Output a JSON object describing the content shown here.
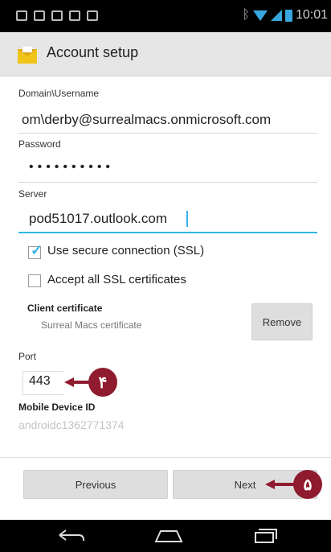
{
  "statusbar": {
    "time": "10:01"
  },
  "actionbar": {
    "title": "Account setup"
  },
  "form": {
    "domain_label": "Domain\\Username",
    "domain_value": "om\\derby@surrealmacs.onmicrosoft.com",
    "password_label": "Password",
    "password_value": "••••••••••",
    "server_label": "Server",
    "server_value": "pod51017.outlook.com",
    "ssl_label": "Use secure connection (SSL)",
    "ssl_checked": true,
    "accept_ssl_label": "Accept all SSL certificates",
    "accept_ssl_checked": false,
    "client_cert_title": "Client certificate",
    "client_cert_value": "Surreal Macs certificate",
    "remove_label": "Remove",
    "port_label": "Port",
    "port_value": "443",
    "device_id_label": "Mobile Device ID",
    "device_id_value": "androidc1362771374"
  },
  "buttons": {
    "previous": "Previous",
    "next": "Next"
  },
  "callouts": {
    "port_marker": "۴",
    "next_marker": "۵"
  },
  "colors": {
    "accent": "#33b5e5",
    "callout": "#8e1b2e"
  }
}
